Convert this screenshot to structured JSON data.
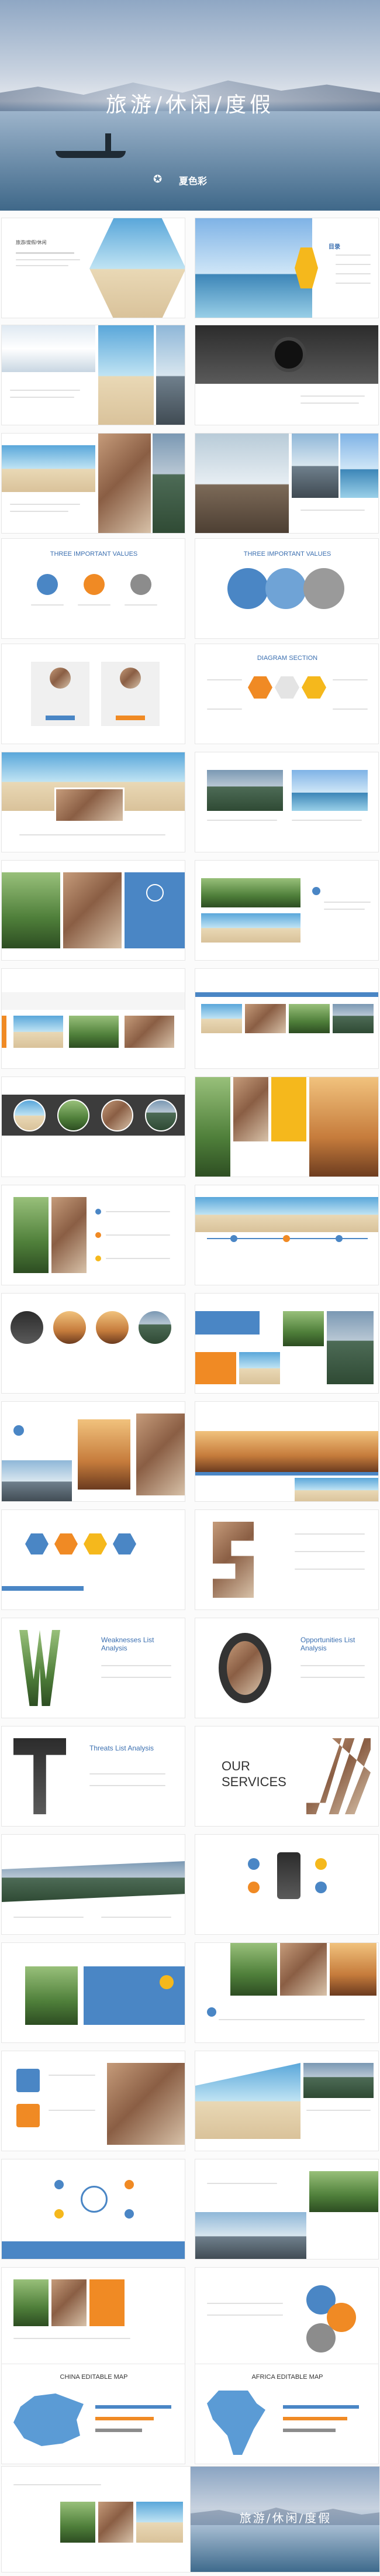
{
  "colors": {
    "blue": "#4a86c5",
    "orange": "#f08a24",
    "yellow": "#f5b81c",
    "grey": "#8c8c8c",
    "dark": "#3c3c3c"
  },
  "cover": {
    "title": "旅游/休闲/度假",
    "logo_text": "夏色彩"
  },
  "end": {
    "title": "旅游/休闲/度假"
  },
  "slides": {
    "s3_heading": "目录",
    "s12_heading": "THREE IMPORTANT VALUES",
    "s13_heading": "THREE IMPORTANT VALUES",
    "s14_heading": "DIAGRAM SECTION",
    "s44_title": "Weaknesses List Analysis",
    "s45_title": "Opportunities List Analysis",
    "s46_title": "Threats List Analysis",
    "s47_title_1": "OUR",
    "s47_title_2": "SERVICES",
    "s62_heading": "CHINA EDITABLE MAP",
    "s63_heading": "AFRICA EDITABLE MAP"
  }
}
